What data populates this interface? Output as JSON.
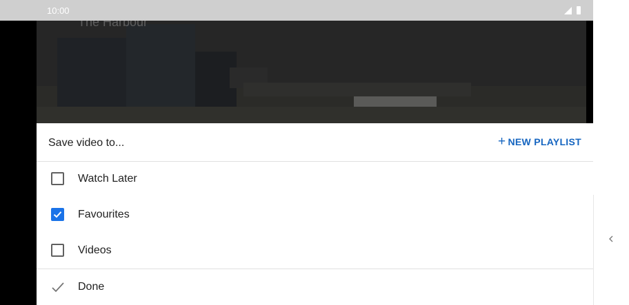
{
  "status_bar": {
    "time": "10:00"
  },
  "video": {
    "title": "The Harbour"
  },
  "sheet": {
    "title": "Save video to...",
    "new_playlist": {
      "icon": "plus-icon",
      "label": "NEW PLAYLIST"
    },
    "playlists": [
      {
        "label": "Watch Later",
        "checked": false
      },
      {
        "label": "Favourites",
        "checked": true
      },
      {
        "label": "Videos",
        "checked": false
      }
    ],
    "done": {
      "icon": "checkmark-icon",
      "label": "Done"
    }
  },
  "colors": {
    "accent": "#1a73e8",
    "link": "#1565c0"
  }
}
